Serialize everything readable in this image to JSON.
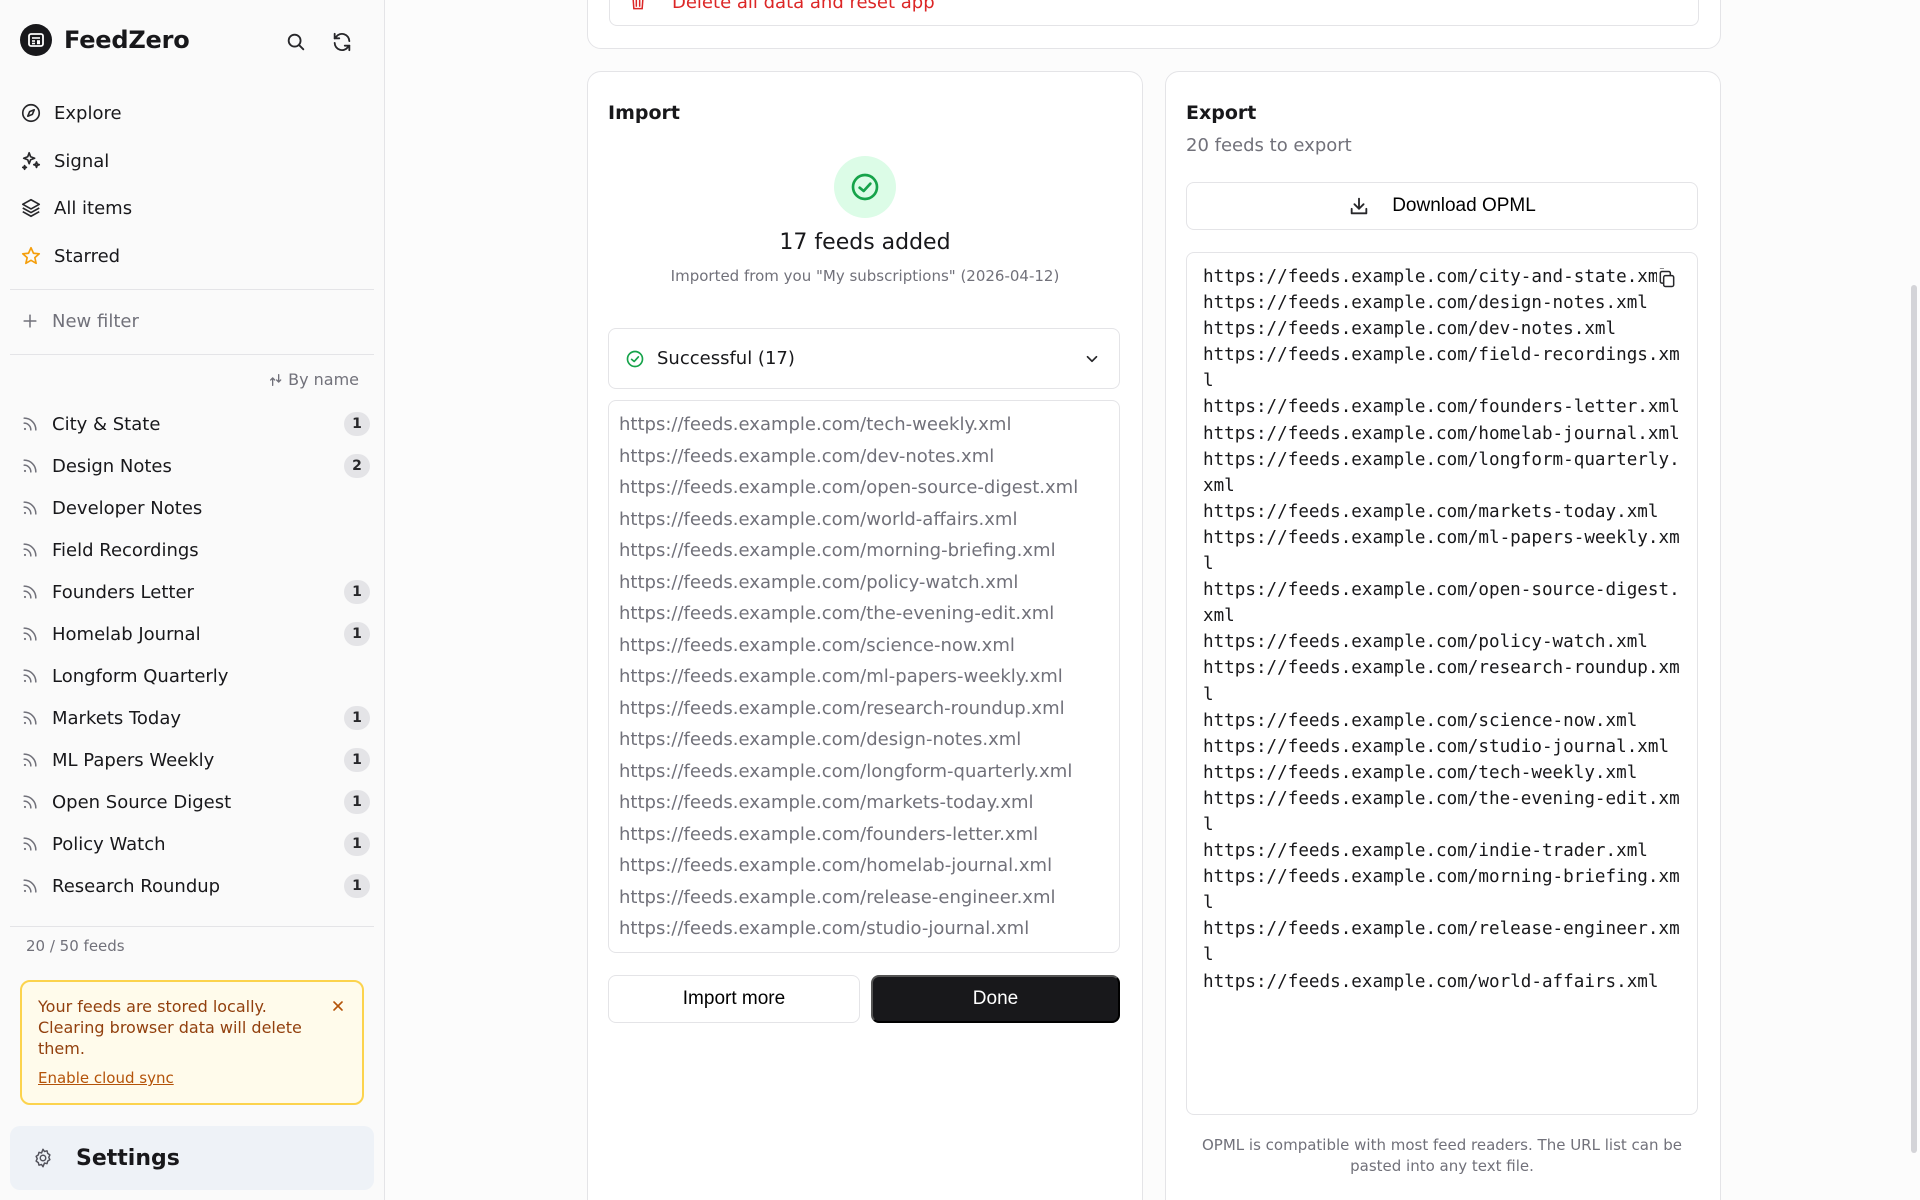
{
  "app": {
    "name": "FeedZero"
  },
  "nav": [
    {
      "label": "Explore",
      "icon": "compass-icon"
    },
    {
      "label": "Signal",
      "icon": "sparkles-icon"
    },
    {
      "label": "All items",
      "icon": "layers-icon"
    },
    {
      "label": "Starred",
      "icon": "star-icon"
    }
  ],
  "new_filter": "New filter",
  "sort_label": "By name",
  "feeds": [
    {
      "name": "City & State",
      "count": "1"
    },
    {
      "name": "Design Notes",
      "count": "2"
    },
    {
      "name": "Developer Notes",
      "count": ""
    },
    {
      "name": "Field Recordings",
      "count": ""
    },
    {
      "name": "Founders Letter",
      "count": "1"
    },
    {
      "name": "Homelab Journal",
      "count": "1"
    },
    {
      "name": "Longform Quarterly",
      "count": ""
    },
    {
      "name": "Markets Today",
      "count": "1"
    },
    {
      "name": "ML Papers Weekly",
      "count": "1"
    },
    {
      "name": "Open Source Digest",
      "count": "1"
    },
    {
      "name": "Policy Watch",
      "count": "1"
    },
    {
      "name": "Research Roundup",
      "count": "1"
    }
  ],
  "feeds_count": "20 / 50 feeds",
  "notice": {
    "text": "Your feeds are stored locally. Clearing browser data will delete them.",
    "link": "Enable cloud sync"
  },
  "settings_label": "Settings",
  "danger": {
    "reset_label": "Delete all data and reset app"
  },
  "import": {
    "title": "Import",
    "added": "17 feeds added",
    "source": "Imported from you \"My subscriptions\" (2026-04-12)",
    "status_label": "Successful (17)",
    "urls": [
      "https://feeds.example.com/tech-weekly.xml",
      "https://feeds.example.com/dev-notes.xml",
      "https://feeds.example.com/open-source-digest.xml",
      "https://feeds.example.com/world-affairs.xml",
      "https://feeds.example.com/morning-briefing.xml",
      "https://feeds.example.com/policy-watch.xml",
      "https://feeds.example.com/the-evening-edit.xml",
      "https://feeds.example.com/science-now.xml",
      "https://feeds.example.com/ml-papers-weekly.xml",
      "https://feeds.example.com/research-roundup.xml",
      "https://feeds.example.com/design-notes.xml",
      "https://feeds.example.com/longform-quarterly.xml",
      "https://feeds.example.com/markets-today.xml",
      "https://feeds.example.com/founders-letter.xml",
      "https://feeds.example.com/homelab-journal.xml",
      "https://feeds.example.com/release-engineer.xml",
      "https://feeds.example.com/studio-journal.xml"
    ],
    "import_more_label": "Import more",
    "done_label": "Done"
  },
  "export": {
    "title": "Export",
    "subtitle": "20 feeds to export",
    "download_label": "Download OPML",
    "urls": [
      "https://feeds.example.com/city-and-state.xml",
      "https://feeds.example.com/design-notes.xml",
      "https://feeds.example.com/dev-notes.xml",
      "https://feeds.example.com/field-recordings.xml",
      "https://feeds.example.com/founders-letter.xml",
      "https://feeds.example.com/homelab-journal.xml",
      "https://feeds.example.com/longform-quarterly.xml",
      "https://feeds.example.com/markets-today.xml",
      "https://feeds.example.com/ml-papers-weekly.xml",
      "https://feeds.example.com/open-source-digest.xml",
      "https://feeds.example.com/policy-watch.xml",
      "https://feeds.example.com/research-roundup.xml",
      "https://feeds.example.com/science-now.xml",
      "https://feeds.example.com/studio-journal.xml",
      "https://feeds.example.com/tech-weekly.xml",
      "https://feeds.example.com/the-evening-edit.xml",
      "https://feeds.example.com/indie-trader.xml",
      "https://feeds.example.com/morning-briefing.xml",
      "https://feeds.example.com/release-engineer.xml",
      "https://feeds.example.com/world-affairs.xml"
    ],
    "note": "OPML is compatible with most feed readers. The URL list can be pasted into any text file."
  },
  "colors": {
    "accent_dark": "#18181b",
    "danger": "#dc2626",
    "success": "#16a34a",
    "success_bg": "#dcfce7",
    "notice_bg": "#fffbeb",
    "notice_border": "#fcd34d",
    "star": "#f59e0b"
  }
}
